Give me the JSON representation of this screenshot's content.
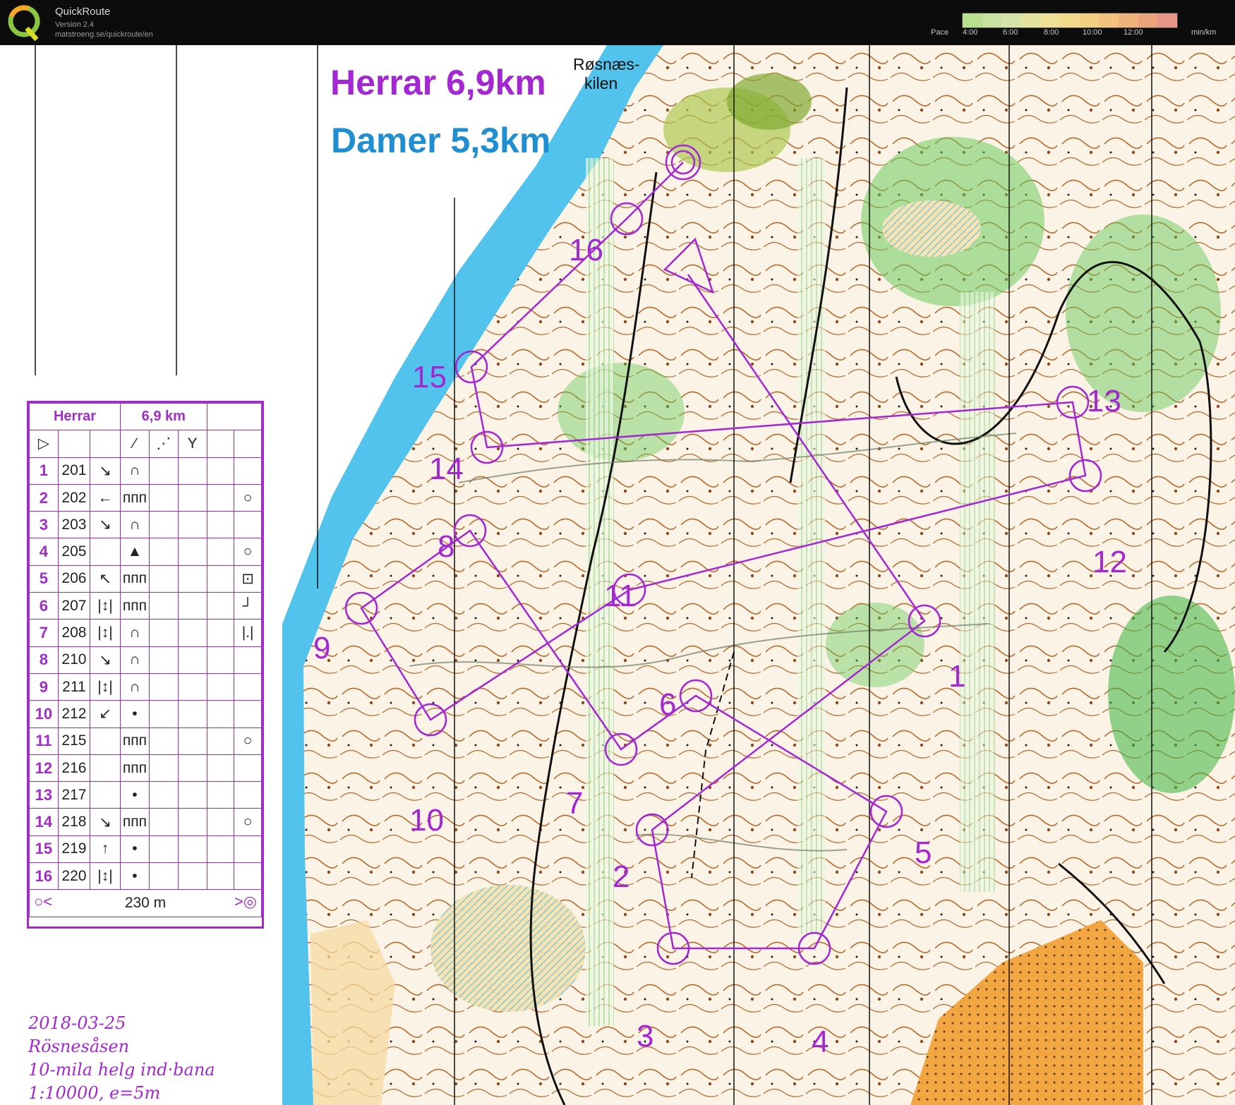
{
  "app": {
    "name": "QuickRoute",
    "version": "Version 2.4",
    "url": "matstroeng.se/quickroute/en"
  },
  "pace_legend": {
    "label": "Pace",
    "unit": "min/km",
    "ticks": [
      "4:00",
      "6:00",
      "8:00",
      "10:00",
      "12:00"
    ],
    "colors": [
      "#b9e08e",
      "#c8e3a1",
      "#d6e3a8",
      "#e4e2a0",
      "#efe096",
      "#f3d98b",
      "#f3cf82",
      "#f1c27c",
      "#eeb27a",
      "#eba37c",
      "#e9968a"
    ]
  },
  "map": {
    "title_men": "Herrar 6,9km",
    "title_women": "Damer 5,3km",
    "place_line1": "Røsnæs-",
    "place_line2": "kilen",
    "colors": {
      "course": "#a427d4",
      "women": "#1f8fd1",
      "water": "#52c3ec",
      "forest_light": "#d9f0c9",
      "open": "#f5d9a1",
      "green": "#62c955",
      "contour": "#b8692a"
    }
  },
  "controls": [
    {
      "label": "1"
    },
    {
      "label": "2"
    },
    {
      "label": "3"
    },
    {
      "label": "4"
    },
    {
      "label": "5"
    },
    {
      "label": "6"
    },
    {
      "label": "7"
    },
    {
      "label": "8"
    },
    {
      "label": "9"
    },
    {
      "label": "10"
    },
    {
      "label": "11"
    },
    {
      "label": "12"
    },
    {
      "label": "13"
    },
    {
      "label": "14"
    },
    {
      "label": "15"
    },
    {
      "label": "16"
    }
  ],
  "description_sheet": {
    "course": "Herrar",
    "length": "6,9 km",
    "finish_distance": "230 m",
    "rows": [
      {
        "num": "1",
        "code": "201",
        "dir": "↘",
        "feat": "∩",
        "app": ""
      },
      {
        "num": "2",
        "code": "202",
        "dir": "←",
        "feat": "ᴨᴨᴨ",
        "app": "○"
      },
      {
        "num": "3",
        "code": "203",
        "dir": "↘",
        "feat": "∩",
        "app": ""
      },
      {
        "num": "4",
        "code": "205",
        "dir": "",
        "feat": "▲",
        "app": "○"
      },
      {
        "num": "5",
        "code": "206",
        "dir": "↖",
        "feat": "ᴨᴨᴨ",
        "app": "⊡"
      },
      {
        "num": "6",
        "code": "207",
        "dir": "|↕|",
        "feat": "ᴨᴨᴨ",
        "app": "┘"
      },
      {
        "num": "7",
        "code": "208",
        "dir": "|↕|",
        "feat": "∩",
        "app": "|.|"
      },
      {
        "num": "8",
        "code": "210",
        "dir": "↘",
        "feat": "∩",
        "app": ""
      },
      {
        "num": "9",
        "code": "211",
        "dir": "|↕|",
        "feat": "∩",
        "app": ""
      },
      {
        "num": "10",
        "code": "212",
        "dir": "↙",
        "feat": "•",
        "app": ""
      },
      {
        "num": "11",
        "code": "215",
        "dir": "",
        "feat": "ᴨᴨᴨ",
        "app": "○"
      },
      {
        "num": "12",
        "code": "216",
        "dir": "",
        "feat": "ᴨᴨᴨ",
        "app": ""
      },
      {
        "num": "13",
        "code": "217",
        "dir": "",
        "feat": "•",
        "app": ""
      },
      {
        "num": "14",
        "code": "218",
        "dir": "↘",
        "feat": "ᴨᴨᴨ",
        "app": "○"
      },
      {
        "num": "15",
        "code": "219",
        "dir": "↑",
        "feat": "•",
        "app": ""
      },
      {
        "num": "16",
        "code": "220",
        "dir": "|↕|",
        "feat": "•",
        "app": ""
      }
    ]
  },
  "info": {
    "date": "2018-03-25",
    "area": "Rösnesåsen",
    "event": "10-mila helg ind·bana",
    "scale": "1:10000, e=5m"
  }
}
